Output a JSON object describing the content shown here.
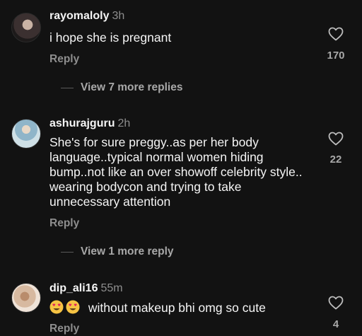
{
  "comments": [
    {
      "username": "rayomaloly",
      "time": "3h",
      "text": "i hope she is pregnant",
      "reply_label": "Reply",
      "likes": "170",
      "view_more": "View 7 more replies"
    },
    {
      "username": "ashurajguru",
      "time": "2h",
      "text": "She's for sure preggy..as per her body language..typical normal women hiding bump..not like an over showoff celebrity style.. wearing bodycon and trying to take unnecessary attention",
      "reply_label": "Reply",
      "likes": "22",
      "view_more": "View 1 more reply"
    },
    {
      "username": "dip_ali16",
      "time": "55m",
      "text": "without makeup bhi omg so cute",
      "reply_label": "Reply",
      "likes": "4"
    }
  ]
}
